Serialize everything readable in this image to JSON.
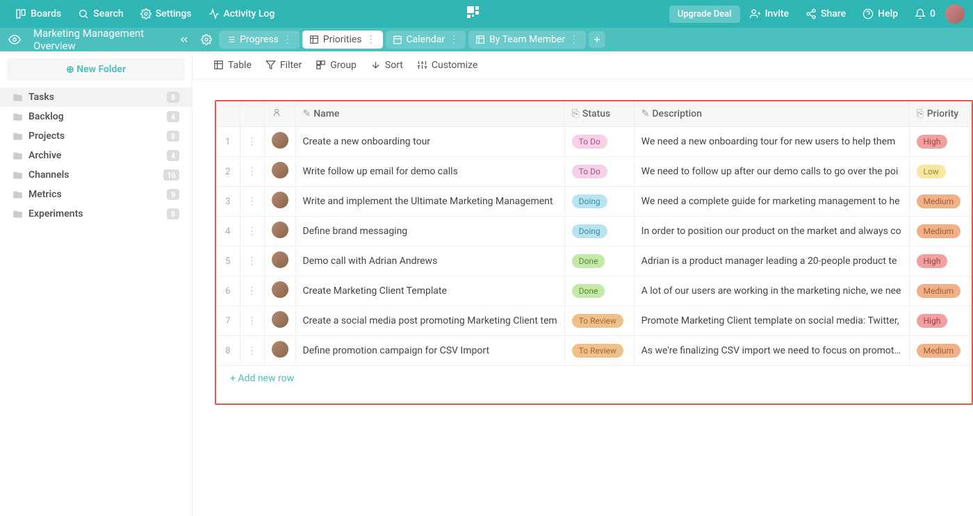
{
  "topnav": {
    "boards": "Boards",
    "search": "Search",
    "settings": "Settings",
    "activity": "Activity Log",
    "upgrade": "Upgrade Deal",
    "invite": "Invite",
    "share": "Share",
    "help": "Help",
    "notifications": "0"
  },
  "subhead": {
    "title": "Marketing Management Overview"
  },
  "tabs": [
    {
      "label": "Progress"
    },
    {
      "label": "Priorities"
    },
    {
      "label": "Calendar"
    },
    {
      "label": "By Team Member"
    }
  ],
  "sidebar": {
    "new_folder": "New Folder",
    "items": [
      {
        "label": "Tasks",
        "count": "8"
      },
      {
        "label": "Backlog",
        "count": "4"
      },
      {
        "label": "Projects",
        "count": "8"
      },
      {
        "label": "Archive",
        "count": "4"
      },
      {
        "label": "Channels",
        "count": "16"
      },
      {
        "label": "Metrics",
        "count": "9"
      },
      {
        "label": "Experiments",
        "count": "8"
      }
    ]
  },
  "toolbar": {
    "table": "Table",
    "filter": "Filter",
    "group": "Group",
    "sort": "Sort",
    "customize": "Customize"
  },
  "columns": {
    "name": "Name",
    "status": "Status",
    "description": "Description",
    "priority": "Priority"
  },
  "rows": [
    {
      "num": "1",
      "name": "Create a new onboarding tour",
      "status": "To Do",
      "status_cls": "todo",
      "desc": "We need a new onboarding tour for new users to help them ",
      "priority": "High",
      "priority_cls": "high"
    },
    {
      "num": "2",
      "name": "Write follow up email for demo calls",
      "status": "To Do",
      "status_cls": "todo",
      "desc": "We need to follow up after our demo calls to go over the poi",
      "priority": "Low",
      "priority_cls": "low"
    },
    {
      "num": "3",
      "name": "Write and implement the Ultimate Marketing Management",
      "status": "Doing",
      "status_cls": "doing",
      "desc": "We need a complete guide for marketing management to he",
      "priority": "Medium",
      "priority_cls": "medium"
    },
    {
      "num": "4",
      "name": "Define brand messaging",
      "status": "Doing",
      "status_cls": "doing",
      "desc": "In order to position our product on the market and always co",
      "priority": "Medium",
      "priority_cls": "medium"
    },
    {
      "num": "5",
      "name": "Demo call with Adrian Andrews",
      "status": "Done",
      "status_cls": "done",
      "desc": "Adrian is a product manager leading a 20-people product te",
      "priority": "High",
      "priority_cls": "high"
    },
    {
      "num": "6",
      "name": "Create Marketing Client Template",
      "status": "Done",
      "status_cls": "done",
      "desc": "A lot of our users are working in the marketing niche, we nee",
      "priority": "Medium",
      "priority_cls": "medium"
    },
    {
      "num": "7",
      "name": "Create a social media post promoting Marketing Client tem",
      "status": "To Review",
      "status_cls": "review",
      "desc": "Promote Marketing Client template on social media: Twitter,",
      "priority": "High",
      "priority_cls": "high"
    },
    {
      "num": "8",
      "name": "Define promotion campaign for CSV Import",
      "status": "To Review",
      "status_cls": "review",
      "desc": "As we're finalizing CSV import we need to focus on promotin",
      "priority": "Medium",
      "priority_cls": "medium"
    }
  ],
  "add_row": "Add new row"
}
